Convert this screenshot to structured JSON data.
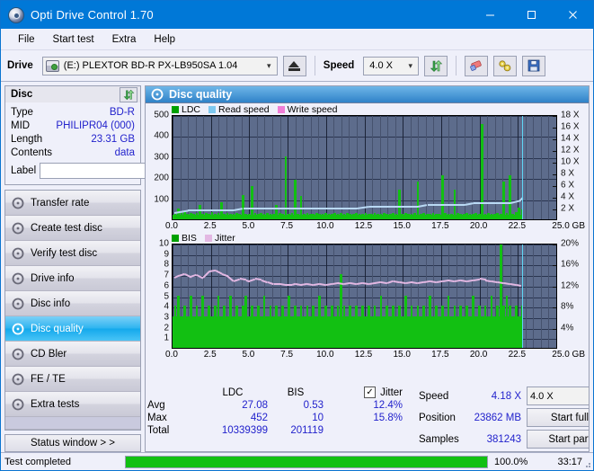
{
  "window": {
    "title": "Opti Drive Control 1.70",
    "icon": "disc-icon",
    "minimize": "–",
    "maximize": "□",
    "close": "✕"
  },
  "menu": {
    "items": [
      "File",
      "Start test",
      "Extra",
      "Help"
    ]
  },
  "toolbar": {
    "drive_label": "Drive",
    "drive_value": "(E:)   PLEXTOR BD-R  PX-LB950SA 1.04",
    "eject_icon": "eject-icon",
    "speed_label": "Speed",
    "speed_value": "4.0 X",
    "refresh_icon": "refresh-icon",
    "erase_icon": "eraser-icon",
    "tools_icon": "tools-icon",
    "save_icon": "save-icon"
  },
  "disc_panel": {
    "title": "Disc",
    "refresh_icon": "refresh-icon",
    "rows": [
      {
        "key": "Type",
        "value": "BD-R"
      },
      {
        "key": "MID",
        "value": "PHILIPR04 (000)"
      },
      {
        "key": "Length",
        "value": "23.31 GB"
      },
      {
        "key": "Contents",
        "value": "data"
      }
    ],
    "label_key": "Label",
    "label_value": "",
    "label_placeholder": "",
    "disc_icon": "disc-icon"
  },
  "sidebar": {
    "items": [
      {
        "label": "Transfer rate",
        "selected": false
      },
      {
        "label": "Create test disc",
        "selected": false
      },
      {
        "label": "Verify test disc",
        "selected": false
      },
      {
        "label": "Drive info",
        "selected": false
      },
      {
        "label": "Disc info",
        "selected": false
      },
      {
        "label": "Disc quality",
        "selected": true
      },
      {
        "label": "CD Bler",
        "selected": false
      },
      {
        "label": "FE / TE",
        "selected": false
      },
      {
        "label": "Extra tests",
        "selected": false
      }
    ],
    "status_button": "Status window > >"
  },
  "content": {
    "title": "Disc quality",
    "title_icon": "disc-icon"
  },
  "chart_data": [
    {
      "type": "bar",
      "id": "ldc-chart",
      "title": "",
      "xlabel": "GB",
      "ylabel": "",
      "xlim": [
        0,
        25
      ],
      "ylim": [
        0,
        500
      ],
      "y2lim": [
        0,
        18
      ],
      "grid": true,
      "legend_position": "top-left",
      "legend": [
        {
          "label": "LDC",
          "color": "#00a000"
        },
        {
          "label": "Read speed",
          "color": "#7ec8ef"
        },
        {
          "label": "Write speed",
          "color": "#ef7ed6"
        }
      ],
      "xticks": [
        "0.0",
        "2.5",
        "5.0",
        "7.5",
        "10.0",
        "12.5",
        "15.0",
        "17.5",
        "20.0",
        "22.5",
        "25.0"
      ],
      "x_unit": "GB",
      "yticks": [
        100,
        200,
        300,
        400,
        500
      ],
      "y2ticks": [
        "2 X",
        "4 X",
        "6 X",
        "8 X",
        "10 X",
        "12 X",
        "14 X",
        "16 X",
        "18 X"
      ],
      "series": [
        {
          "name": "LDC",
          "color": "#12c012",
          "type": "bar",
          "x": [
            0.1,
            0.3,
            0.5,
            0.7,
            0.9,
            1.1,
            1.3,
            1.5,
            1.7,
            1.9,
            2.1,
            2.3,
            2.5,
            2.7,
            2.9,
            3.1,
            3.3,
            3.5,
            3.7,
            3.9,
            4.1,
            4.3,
            4.5,
            4.7,
            4.9,
            5.1,
            5.3,
            5.5,
            5.7,
            5.9,
            6.1,
            6.3,
            6.5,
            6.7,
            6.9,
            7.1,
            7.3,
            7.5,
            7.7,
            7.9,
            8.1,
            8.3,
            8.5,
            8.7,
            8.9,
            9.1,
            9.3,
            9.5,
            9.7,
            9.9,
            10.1,
            10.3,
            10.5,
            10.7,
            10.9,
            11.1,
            11.3,
            11.5,
            11.7,
            11.9,
            12.1,
            12.3,
            12.5,
            12.7,
            12.9,
            13.1,
            13.3,
            13.5,
            13.7,
            13.9,
            14.1,
            14.3,
            14.5,
            14.7,
            14.9,
            15.1,
            15.3,
            15.5,
            15.7,
            15.9,
            16.1,
            16.3,
            16.5,
            16.7,
            16.9,
            17.1,
            17.3,
            17.5,
            17.7,
            17.9,
            18.1,
            18.3,
            18.5,
            18.7,
            18.9,
            19.1,
            19.3,
            19.5,
            19.7,
            19.9,
            20.1,
            20.3,
            20.5,
            20.7,
            20.9,
            21.1,
            21.3,
            21.5,
            21.7,
            21.9,
            22.1,
            22.3,
            22.5,
            22.7
          ],
          "values": [
            30,
            52,
            28,
            35,
            26,
            30,
            24,
            28,
            70,
            26,
            30,
            24,
            34,
            26,
            30,
            80,
            26,
            28,
            24,
            26,
            30,
            26,
            115,
            24,
            26,
            160,
            28,
            24,
            30,
            26,
            28,
            24,
            26,
            70,
            28,
            24,
            300,
            26,
            28,
            190,
            24,
            110,
            26,
            28,
            24,
            26,
            30,
            24,
            26,
            28,
            24,
            26,
            28,
            24,
            30,
            26,
            28,
            24,
            26,
            30,
            24,
            26,
            28,
            24,
            26,
            28,
            24,
            26,
            30,
            24,
            26,
            28,
            24,
            140,
            26,
            28,
            24,
            26,
            30,
            180,
            26,
            28,
            24,
            26,
            28,
            24,
            26,
            210,
            28,
            24,
            26,
            140,
            28,
            24,
            26,
            30,
            24,
            26,
            28,
            24,
            452,
            26,
            28,
            24,
            26,
            30,
            24,
            180,
            28,
            210,
            26,
            34,
            55,
            48
          ]
        },
        {
          "name": "Read speed",
          "color": "#b9d9f4",
          "type": "line",
          "x": [
            0.1,
            1.0,
            2.0,
            3.0,
            4.0,
            4.6,
            5.0,
            6.0,
            7.0,
            8.0,
            9.0,
            10.0,
            11.0,
            12.0,
            12.8,
            13.0,
            14.0,
            15.0,
            16.0,
            16.6,
            17.0,
            18.0,
            19.0,
            19.6,
            20.0,
            21.0,
            22.0,
            22.6,
            22.8
          ],
          "values": [
            1.6,
            2.0,
            2.0,
            2.0,
            2.0,
            2.3,
            2.3,
            2.3,
            2.3,
            2.3,
            2.3,
            2.3,
            2.3,
            2.3,
            2.6,
            2.6,
            2.6,
            2.6,
            2.6,
            2.9,
            2.9,
            2.9,
            2.9,
            3.2,
            3.2,
            3.2,
            3.2,
            3.6,
            4.2
          ]
        }
      ],
      "end_marker": {
        "x": 22.8,
        "color": "#5fd6f5"
      }
    },
    {
      "type": "bar",
      "id": "bis-chart",
      "title": "",
      "xlabel": "GB",
      "ylabel": "",
      "xlim": [
        0,
        25
      ],
      "ylim": [
        0,
        10
      ],
      "y2lim": [
        0,
        20
      ],
      "grid": true,
      "legend_position": "top-left",
      "legend": [
        {
          "label": "BIS",
          "color": "#00a000"
        },
        {
          "label": "Jitter",
          "color": "#e3b8e3"
        }
      ],
      "xticks": [
        "0.0",
        "2.5",
        "5.0",
        "7.5",
        "10.0",
        "12.5",
        "15.0",
        "17.5",
        "20.0",
        "22.5",
        "25.0"
      ],
      "x_unit": "GB",
      "yticks": [
        1,
        2,
        3,
        4,
        5,
        6,
        7,
        8,
        9,
        10
      ],
      "y2ticks": [
        "4%",
        "8%",
        "12%",
        "16%",
        "20%"
      ],
      "series": [
        {
          "name": "BIS",
          "color": "#12c012",
          "type": "bar",
          "x": [
            0.1,
            0.3,
            0.5,
            0.7,
            0.9,
            1.1,
            1.3,
            1.5,
            1.7,
            1.9,
            2.1,
            2.3,
            2.5,
            2.7,
            2.9,
            3.1,
            3.3,
            3.5,
            3.7,
            3.9,
            4.1,
            4.3,
            4.5,
            4.7,
            4.9,
            5.1,
            5.3,
            5.5,
            5.7,
            5.9,
            6.1,
            6.3,
            6.5,
            6.7,
            6.9,
            7.1,
            7.3,
            7.5,
            7.7,
            7.9,
            8.1,
            8.3,
            8.5,
            8.7,
            8.9,
            9.1,
            9.3,
            9.5,
            9.7,
            9.9,
            10.1,
            10.3,
            10.5,
            10.7,
            10.9,
            11.1,
            11.3,
            11.5,
            11.7,
            11.9,
            12.1,
            12.3,
            12.5,
            12.7,
            12.9,
            13.1,
            13.3,
            13.5,
            13.7,
            13.9,
            14.1,
            14.3,
            14.5,
            14.7,
            14.9,
            15.1,
            15.3,
            15.5,
            15.7,
            15.9,
            16.1,
            16.3,
            16.5,
            16.7,
            16.9,
            17.1,
            17.3,
            17.5,
            17.7,
            17.9,
            18.1,
            18.3,
            18.5,
            18.7,
            18.9,
            19.1,
            19.3,
            19.5,
            19.7,
            19.9,
            20.1,
            20.3,
            20.5,
            20.7,
            20.9,
            21.1,
            21.3,
            21.5,
            21.7,
            21.9,
            22.1,
            22.3,
            22.5,
            22.7
          ],
          "values": [
            4,
            5,
            3,
            4,
            3,
            5,
            3,
            4,
            3,
            5,
            3,
            4,
            3,
            4,
            5,
            3,
            4,
            3,
            5,
            3,
            4,
            3,
            4,
            5,
            3,
            4,
            3,
            4,
            3,
            5,
            3,
            4,
            3,
            4,
            3,
            4,
            3,
            5,
            3,
            4,
            3,
            4,
            3,
            4,
            3,
            4,
            3,
            5,
            3,
            4,
            3,
            4,
            3,
            4,
            7,
            4,
            3,
            4,
            3,
            4,
            3,
            4,
            3,
            4,
            3,
            4,
            3,
            5,
            3,
            4,
            3,
            4,
            3,
            4,
            3,
            5,
            3,
            4,
            3,
            4,
            3,
            4,
            3,
            5,
            3,
            4,
            3,
            4,
            3,
            5,
            3,
            4,
            3,
            4,
            3,
            4,
            3,
            5,
            3,
            4,
            3,
            4,
            3,
            5,
            3,
            4,
            10,
            4,
            5,
            4,
            3,
            4,
            3,
            4
          ]
        },
        {
          "name": "Jitter",
          "color": "#e3b8e3",
          "type": "line",
          "x": [
            0.1,
            0.4,
            0.8,
            1.2,
            1.6,
            2.0,
            2.4,
            2.8,
            3.2,
            3.6,
            4.0,
            4.4,
            4.8,
            5.0,
            5.4,
            5.8,
            6.2,
            6.6,
            7.0,
            7.4,
            7.8,
            8.0,
            8.4,
            8.8,
            9.2,
            9.6,
            10.0,
            10.4,
            10.8,
            11.2,
            11.6,
            12.0,
            12.4,
            12.8,
            13.2,
            13.6,
            14.0,
            14.4,
            14.8,
            15.2,
            15.6,
            16.0,
            16.4,
            16.8,
            17.2,
            17.6,
            18.0,
            18.4,
            18.8,
            19.2,
            19.6,
            20.0,
            20.4,
            20.8,
            21.2,
            21.6,
            22.0,
            22.4,
            22.7
          ],
          "values": [
            6.9,
            7.1,
            7.3,
            7.0,
            7.2,
            6.9,
            7.5,
            7.6,
            7.3,
            7.1,
            6.6,
            6.8,
            6.7,
            6.6,
            6.8,
            6.7,
            6.5,
            6.3,
            6.3,
            6.2,
            6.2,
            6.3,
            6.2,
            6.3,
            6.2,
            6.3,
            6.2,
            6.3,
            6.4,
            6.3,
            6.4,
            6.3,
            6.4,
            6.3,
            6.4,
            6.5,
            6.4,
            6.6,
            6.5,
            6.4,
            6.5,
            6.4,
            6.5,
            6.6,
            6.5,
            6.6,
            6.7,
            6.6,
            6.7,
            6.6,
            6.7,
            6.8,
            6.7,
            6.6,
            6.5,
            6.4,
            6.3,
            6.2,
            6.1
          ]
        }
      ],
      "end_marker": {
        "x": 22.8,
        "color": "#5fd6f5"
      }
    }
  ],
  "stats": {
    "col_ldc": "LDC",
    "col_bis": "BIS",
    "jitter_label": "Jitter",
    "jitter_checked": true,
    "jitter_check_glyph": "✓",
    "rows": [
      {
        "label": "Avg",
        "ldc": "27.08",
        "bis": "0.53",
        "jitter": "12.4%"
      },
      {
        "label": "Max",
        "ldc": "452",
        "bis": "10",
        "jitter": "15.8%"
      },
      {
        "label": "Total",
        "ldc": "10339399",
        "bis": "201119",
        "jitter": ""
      }
    ]
  },
  "test_panel": {
    "speed_label": "Speed",
    "speed_value": "4.18 X",
    "position_label": "Position",
    "position_value": "23862 MB",
    "samples_label": "Samples",
    "samples_value": "381243",
    "speed_select": "4.0 X",
    "start_full": "Start full",
    "start_part": "Start part"
  },
  "statusbar": {
    "text": "Test completed",
    "progress_percent": 100.0,
    "progress_label": "100.0%",
    "time": "33:17"
  }
}
